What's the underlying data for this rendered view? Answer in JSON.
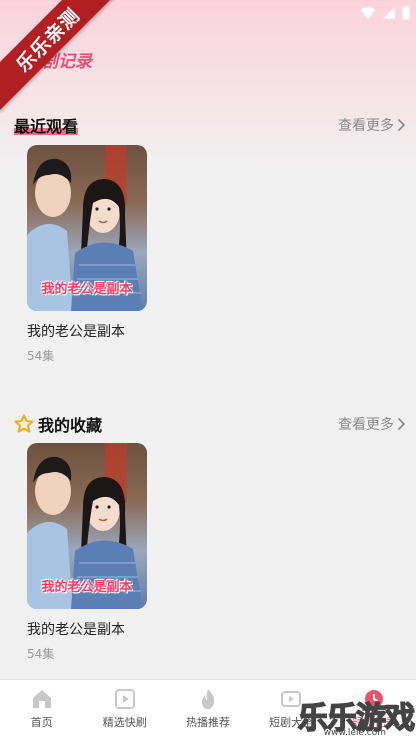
{
  "status_bar": {
    "icons": [
      "wifi-icon",
      "signal-icon",
      "battery-icon"
    ]
  },
  "corner_banner": {
    "text": "乐乐亲测"
  },
  "header": {
    "title": "短剧记录"
  },
  "recent": {
    "title": "最近观看",
    "more_label": "查看更多",
    "items": [
      {
        "title": "我的老公是副本",
        "episodes": "54集",
        "poster_caption": "我的老公是副本"
      }
    ]
  },
  "favorites": {
    "title": "我的收藏",
    "icon": "star-icon",
    "more_label": "查看更多",
    "items": [
      {
        "title": "我的老公是副本",
        "episodes": "54集",
        "poster_caption": "我的老公是副本"
      }
    ]
  },
  "bottom_nav": {
    "items": [
      {
        "label": "首页",
        "icon": "home-icon"
      },
      {
        "label": "精选快刷",
        "icon": "play-square-icon"
      },
      {
        "label": "热播推荐",
        "icon": "flame-icon"
      },
      {
        "label": "短剧大全",
        "icon": "video-icon"
      },
      {
        "label": "短剧记录",
        "icon": "record-icon"
      }
    ]
  },
  "watermark": {
    "text": "乐乐游戏",
    "sub": "www.lele.com"
  },
  "colors": {
    "accent": "#f0506e",
    "banner": "#b21f23",
    "star": "#f5a623"
  }
}
